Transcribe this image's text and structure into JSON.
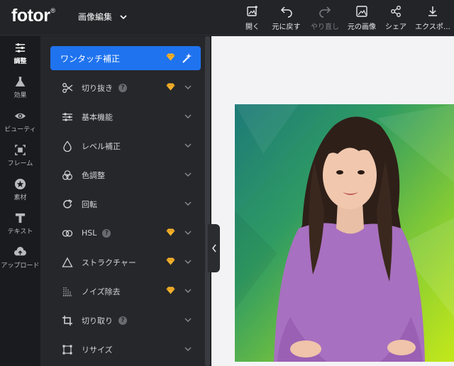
{
  "app": {
    "logo": "fotor",
    "logo_mark": "®"
  },
  "header": {
    "menu_label": "画像編集",
    "tools": [
      {
        "label": "開く",
        "icon": "image-add-icon",
        "enabled": true
      },
      {
        "label": "元に戻す",
        "icon": "undo-icon",
        "enabled": true
      },
      {
        "label": "やり直し",
        "icon": "redo-icon",
        "enabled": false
      },
      {
        "label": "元の画像",
        "icon": "original-image-icon",
        "enabled": true
      },
      {
        "label": "シェア",
        "icon": "share-icon",
        "enabled": true
      },
      {
        "label": "エクスポ…",
        "icon": "download-icon",
        "enabled": true
      }
    ]
  },
  "leftnav": {
    "items": [
      {
        "label": "調整",
        "icon": "sliders-icon",
        "active": true
      },
      {
        "label": "効果",
        "icon": "flask-icon",
        "active": false
      },
      {
        "label": "ビューティ",
        "icon": "eye-icon",
        "active": false
      },
      {
        "label": "フレーム",
        "icon": "frame-icon",
        "active": false
      },
      {
        "label": "素材",
        "icon": "star-icon",
        "active": false
      },
      {
        "label": "テキスト",
        "icon": "text-icon",
        "active": false
      },
      {
        "label": "アップロード",
        "icon": "upload-icon",
        "active": false
      }
    ]
  },
  "panel": {
    "primary": {
      "label": "ワンタッチ補正",
      "premium": true
    },
    "items": [
      {
        "label": "切り抜き",
        "icon": "scissors-icon",
        "help": true,
        "premium": true
      },
      {
        "label": "基本機能",
        "icon": "sliders-icon",
        "help": false,
        "premium": false
      },
      {
        "label": "レベル補正",
        "icon": "drop-icon",
        "help": false,
        "premium": false
      },
      {
        "label": "色調整",
        "icon": "color-circles-icon",
        "help": false,
        "premium": false
      },
      {
        "label": "回転",
        "icon": "rotate-icon",
        "help": false,
        "premium": false
      },
      {
        "label": "HSL",
        "icon": "hsl-icon",
        "help": true,
        "premium": true
      },
      {
        "label": "ストラクチャー",
        "icon": "triangle-icon",
        "help": false,
        "premium": true
      },
      {
        "label": "ノイズ除去",
        "icon": "noise-icon",
        "help": false,
        "premium": true
      },
      {
        "label": "切り取り",
        "icon": "crop-icon",
        "help": true,
        "premium": false
      },
      {
        "label": "リサイズ",
        "icon": "resize-icon",
        "help": false,
        "premium": false
      }
    ],
    "help_glyph": "?"
  },
  "colors": {
    "accent": "#1f73ef",
    "premium": "#f2b12c",
    "panel": "#26272b",
    "topbar": "#232428",
    "canvas": "#f3f3f5"
  }
}
